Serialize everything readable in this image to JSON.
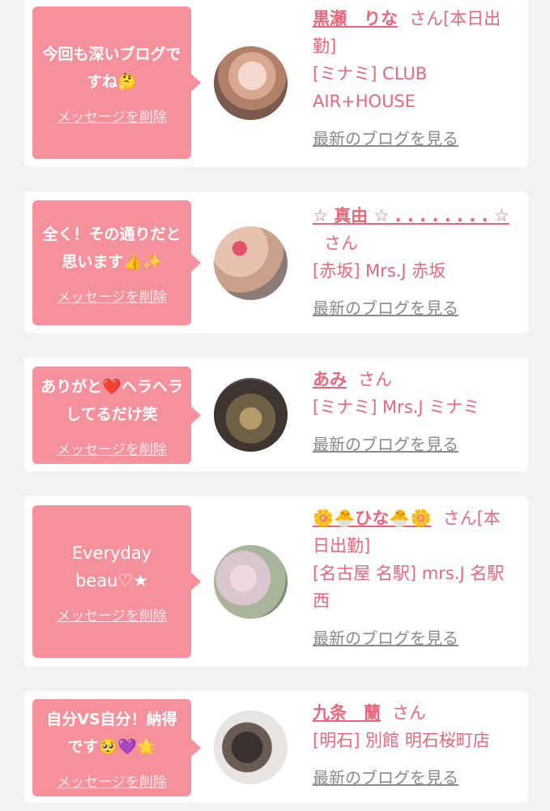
{
  "delete_label": "メッセージを削除",
  "blog_link_label": "最新のブログを見る",
  "san_label": "さん",
  "accent_color": "#f5909d",
  "cards": [
    {
      "message": "今回も深いブログですね🤔",
      "name": "黒瀬　りな",
      "suffix": "[本日出勤]",
      "shop": "[ミナミ] CLUB AIR+HOUSE"
    },
    {
      "message": "全く！その通りだと思います👍✨",
      "name": "☆ 真由 ☆ . . . . . . . . ☆",
      "suffix": "",
      "shop": "[赤坂] Mrs.J 赤坂"
    },
    {
      "message": "ありがと❤️ヘラヘラしてるだけ笑",
      "name": "あみ",
      "suffix": "",
      "shop": "[ミナミ] Mrs.J ミナミ"
    },
    {
      "message": "Everyday beau♡★",
      "name": "🌼🐣ひな🐣🌼",
      "suffix": "[本日出勤]",
      "shop": "[名古屋 名駅] mrs.J 名駅西"
    },
    {
      "message": "自分VS自分！納得です🥺💜🌟",
      "name": "九条　蘭",
      "suffix": "",
      "shop": "[明石] 別館 明石桜町店"
    }
  ]
}
